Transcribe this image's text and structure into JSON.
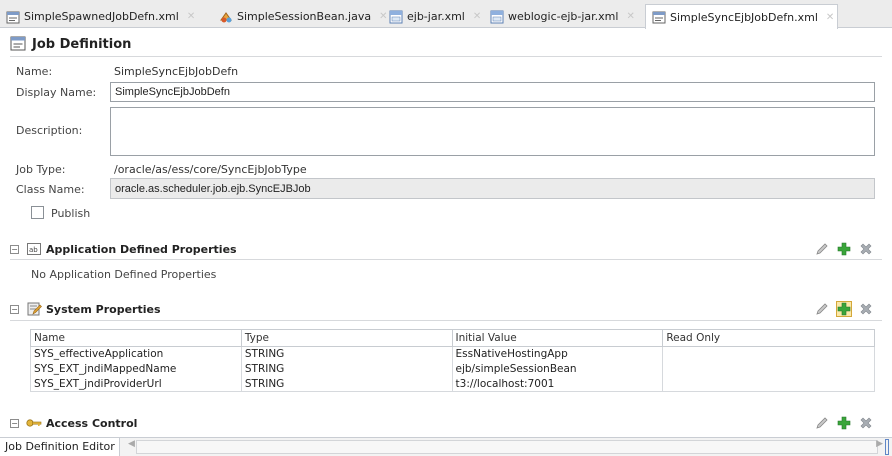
{
  "tabs": [
    {
      "label": "SimpleSpawnedJobDefn.xml",
      "icon": "job-definition-icon"
    },
    {
      "label": "SimpleSessionBean.java",
      "icon": "java-class-icon"
    },
    {
      "label": "ejb-jar.xml",
      "icon": "xml-file-icon"
    },
    {
      "label": "weblogic-ejb-jar.xml",
      "icon": "xml-file-icon"
    },
    {
      "label": "SimpleSyncEjbJobDefn.xml",
      "icon": "job-definition-icon",
      "active": true
    }
  ],
  "header": {
    "title": "Job Definition"
  },
  "form": {
    "name_label": "Name:",
    "name_value": "SimpleSyncEjbJobDefn",
    "display_name_label": "Display Name:",
    "display_name_value": "SimpleSyncEjbJobDefn",
    "description_label": "Description:",
    "description_value": "",
    "job_type_label": "Job Type:",
    "job_type_value": "/oracle/as/ess/core/SyncEjbJobType",
    "class_name_label": "Class Name:",
    "class_name_value": "oracle.as.scheduler.job.ejb.SyncEJBJob",
    "publish_label": "Publish",
    "publish_checked": false
  },
  "app_props": {
    "title": "Application Defined Properties",
    "empty_text": "No Application Defined Properties"
  },
  "sys_props": {
    "title": "System Properties",
    "columns": [
      "Name",
      "Type",
      "Initial Value",
      "Read Only"
    ],
    "rows": [
      [
        "SYS_effectiveApplication",
        "STRING",
        "EssNativeHostingApp",
        ""
      ],
      [
        "SYS_EXT_jndiMappedName",
        "STRING",
        "ejb/simpleSessionBean",
        ""
      ],
      [
        "SYS_EXT_jndiProviderUrl",
        "STRING",
        "t3://localhost:7001",
        ""
      ]
    ]
  },
  "access": {
    "title": "Access Control"
  },
  "status": {
    "tab_label": "Job Definition Editor"
  },
  "colors": {
    "add_green": "#3aa53a",
    "delete_gray": "#9aa0a6",
    "highlight": "#fbe8a9"
  }
}
